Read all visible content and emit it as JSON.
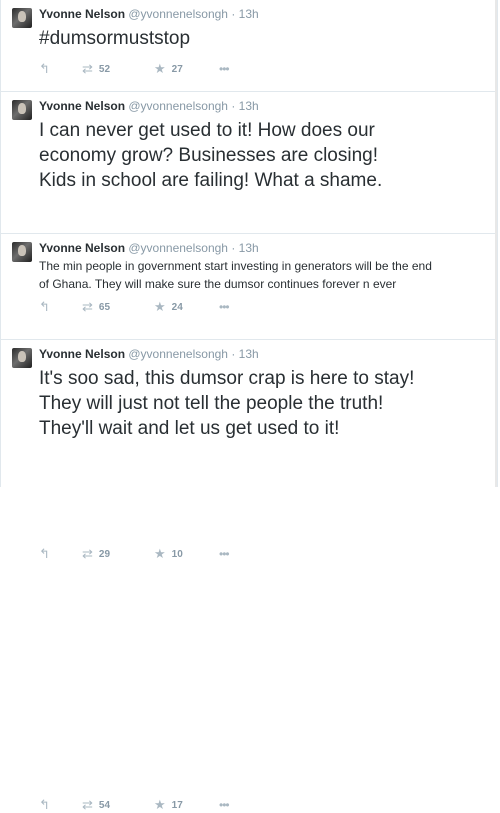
{
  "tweets": [
    {
      "name": "Yvonne Nelson",
      "handle": "@yvonnenelsongh",
      "separator": "·",
      "time": "13h",
      "text": "#dumsormuststop",
      "replies_icon": "reply-icon",
      "retweets": "52",
      "favorites": "27",
      "more_icon": "more-options-icon"
    },
    {
      "name": "Yvonne Nelson",
      "handle": "@yvonnenelsongh",
      "separator": "·",
      "time": "13h",
      "text": "I can never get used to it! How does our\neconomy grow? Businesses are closing!\nKids in school are failing! What a shame.",
      "retweets": "65",
      "favorites": "24"
    },
    {
      "name": "Yvonne Nelson",
      "handle": "@yvonnenelsongh",
      "separator": "·",
      "time": "13h",
      "text": "The min people in government start investing in generators will be the end\nof Ghana. They will make sure the dumsor continues forever n ever",
      "retweets": "29",
      "favorites": "10"
    },
    {
      "name": "Yvonne Nelson",
      "handle": "@yvonnenelsongh",
      "separator": "·",
      "time": "13h",
      "text": "It's soo sad, this dumsor crap is here to stay!\nThey will just not tell the people the truth!\nThey'll wait and let us get used to it!",
      "retweets": "54",
      "favorites": "17"
    }
  ],
  "colors": {
    "hashtag": "#a52a2a",
    "muted": "#8899a6",
    "text": "#292f33",
    "border": "#e1e8ed"
  }
}
